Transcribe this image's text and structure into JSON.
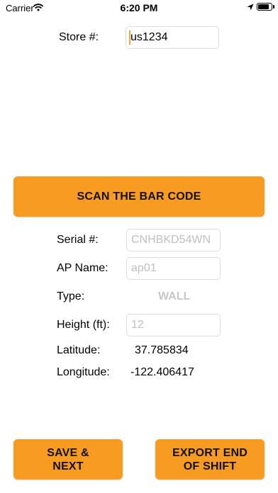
{
  "status_bar": {
    "carrier": "Carrier",
    "time": "6:20 PM",
    "battery_percent": 95
  },
  "store": {
    "label": "Store #:",
    "value": "us1234"
  },
  "scan_button": {
    "label": "SCAN THE BAR CODE"
  },
  "form": {
    "serial_label": "Serial #:",
    "serial_placeholder": "CNHBKD54WN",
    "ap_name_label": "AP Name:",
    "ap_name_placeholder": "ap01",
    "type_label": "Type:",
    "type_value": "WALL",
    "height_label": "Height (ft):",
    "height_placeholder": "12",
    "latitude_label": "Latitude:",
    "latitude_value": "37.785834",
    "longitude_label": "Longitude:",
    "longitude_value": "-122.406417"
  },
  "footer": {
    "save_label": "SAVE &\nNEXT",
    "export_label": "EXPORT END\nOF SHIFT"
  },
  "colors": {
    "accent": "#f79b21",
    "placeholder": "#c0c0c0"
  }
}
